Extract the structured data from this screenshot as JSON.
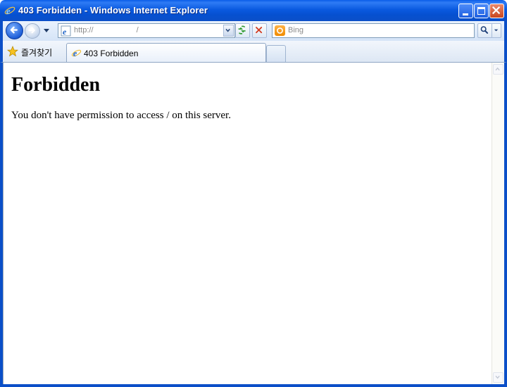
{
  "window": {
    "title": "403 Forbidden - Windows Internet Explorer",
    "accent": "#0b4fc8"
  },
  "navbar": {
    "address_value": "http://                    /",
    "search_placeholder": "Bing",
    "icons": [
      "back-arrow-icon",
      "forward-arrow-icon",
      "refresh-icon",
      "stop-icon",
      "search-icon"
    ]
  },
  "tabbar": {
    "favorites_label": "즐겨찾기",
    "active_tab_label": "403 Forbidden"
  },
  "page": {
    "heading": "Forbidden",
    "message": "You don't have permission to access / on this server."
  }
}
